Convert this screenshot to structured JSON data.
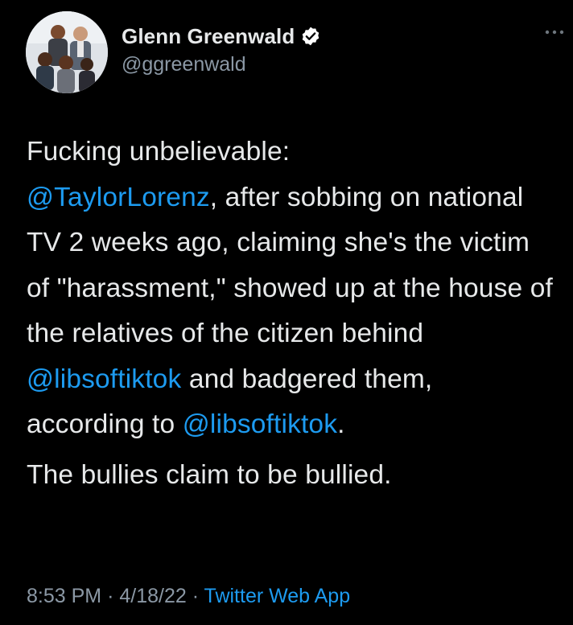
{
  "colors": {
    "background": "#000000",
    "primary_text": "#e7e9ea",
    "secondary_text": "#8b98a5",
    "link": "#1d9bf0",
    "verified_badge": "#ffffff"
  },
  "author": {
    "display_name": "Glenn Greenwald",
    "handle": "@ggreenwald",
    "verified": true,
    "avatar_icon": "profile-photo-group"
  },
  "header": {
    "more_icon": "ellipsis-icon"
  },
  "tweet": {
    "paragraph1": {
      "t1": "Fucking unbelievable:",
      "m1": "@TaylorLorenz",
      "t2": ", after sobbing on national TV 2 weeks ago, claiming she's the victim of \"harassment,\" showed up at the house of the relatives of the citizen behind ",
      "m2": "@libsoftiktok",
      "t3": " and badgered them, according to ",
      "m3": "@libsoftiktok",
      "t4": "."
    },
    "paragraph2": "The bullies claim to be bullied."
  },
  "meta": {
    "time": "8:53 PM",
    "separator": "·",
    "date": "4/18/22",
    "source": "Twitter Web App"
  }
}
